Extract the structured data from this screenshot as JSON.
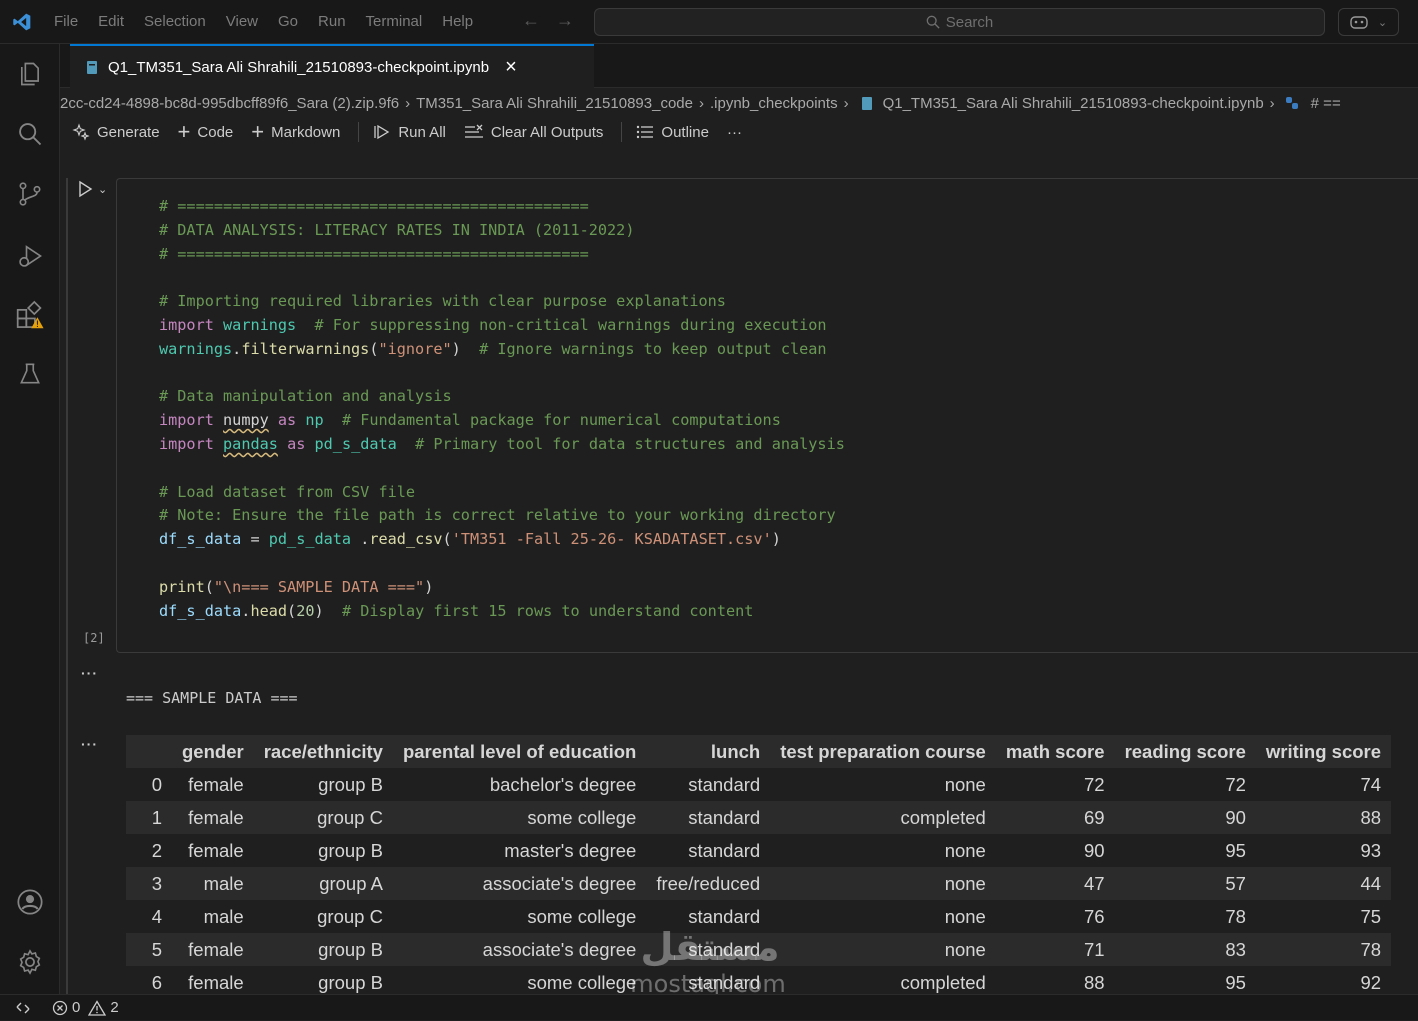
{
  "menu": [
    "File",
    "Edit",
    "Selection",
    "View",
    "Go",
    "Run",
    "Terminal",
    "Help"
  ],
  "search": {
    "placeholder": "Search"
  },
  "tab": {
    "label": "Q1_TM351_Sara Ali Shrahili_21510893-checkpoint.ipynb"
  },
  "breadcrumb": [
    "2cc-cd24-4898-bc8d-995dbcff89f6_Sara (2).zip.9f6",
    "TM351_Sara Ali Shrahili_21510893_code",
    ".ipynb_checkpoints",
    "Q1_TM351_Sara Ali Shrahili_21510893-checkpoint.ipynb",
    "# =="
  ],
  "toolbar": {
    "generate": "Generate",
    "code": "Code",
    "markdown": "Markdown",
    "run_all": "Run All",
    "clear": "Clear All Outputs",
    "outline": "Outline",
    "more": "···"
  },
  "cell": {
    "exec_count": "[2]"
  },
  "output": {
    "dots1": "···",
    "dots2": "···",
    "stdout": "=== SAMPLE DATA ==="
  },
  "table": {
    "headers": [
      "",
      "gender",
      "race/ethnicity",
      "parental level of education",
      "lunch",
      "test preparation course",
      "math score",
      "reading score",
      "writing score"
    ],
    "rows": [
      [
        "0",
        "female",
        "group B",
        "bachelor's degree",
        "standard",
        "none",
        "72",
        "72",
        "74"
      ],
      [
        "1",
        "female",
        "group C",
        "some college",
        "standard",
        "completed",
        "69",
        "90",
        "88"
      ],
      [
        "2",
        "female",
        "group B",
        "master's degree",
        "standard",
        "none",
        "90",
        "95",
        "93"
      ],
      [
        "3",
        "male",
        "group A",
        "associate's degree",
        "free/reduced",
        "none",
        "47",
        "57",
        "44"
      ],
      [
        "4",
        "male",
        "group C",
        "some college",
        "standard",
        "none",
        "76",
        "78",
        "75"
      ],
      [
        "5",
        "female",
        "group B",
        "associate's degree",
        "standard",
        "none",
        "71",
        "83",
        "78"
      ],
      [
        "6",
        "female",
        "group B",
        "some college",
        "standard",
        "completed",
        "88",
        "95",
        "92"
      ]
    ]
  },
  "status": {
    "errors": "0",
    "warnings": "2"
  },
  "watermark": {
    "arabic": "مستقل",
    "latin": "mostaql.com"
  },
  "colors": {
    "accent": "#0078d4",
    "comment": "#6a9955",
    "keyword": "#c586c0",
    "string": "#ce9178"
  }
}
